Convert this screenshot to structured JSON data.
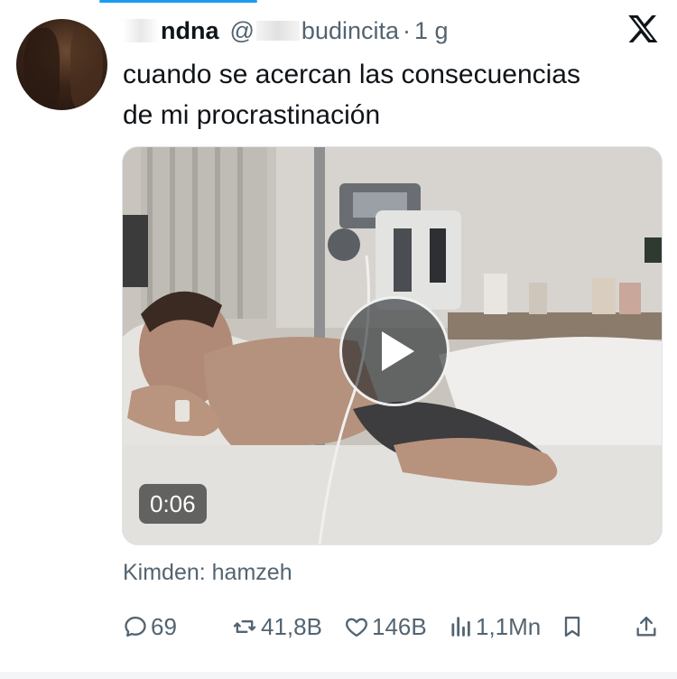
{
  "tweet": {
    "display_name": "ndna",
    "handle": "@",
    "handle_suffix": "budincita",
    "separator": "·",
    "time": "1 g",
    "text_line1": "cuando se acercan las consecuencias",
    "text_line2": "de mi procrastinación",
    "source": "Kimden: hamzeh"
  },
  "media": {
    "duration": "0:06"
  },
  "actions": {
    "replies": "69",
    "retweets": "41,8B",
    "likes": "146B",
    "views": "1,1Mn"
  },
  "icons": {
    "platform": "x-logo-icon",
    "reply": "reply-bubble-icon",
    "retweet": "retweet-icon",
    "like": "heart-icon",
    "views": "views-bar-chart-icon",
    "bookmark": "bookmark-icon",
    "share": "share-upload-icon",
    "play": "play-icon"
  },
  "colors": {
    "accent": "#1d9bf0",
    "text": "#0f1419",
    "muted": "#536471"
  }
}
